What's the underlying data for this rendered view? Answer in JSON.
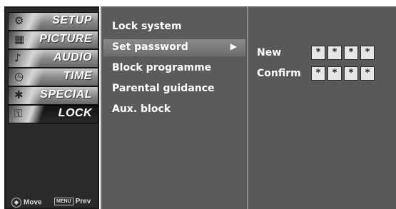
{
  "sidebar": {
    "tabs": [
      {
        "label": "SETUP",
        "icon": "setup-icon",
        "glyph": "⚙"
      },
      {
        "label": "PICTURE",
        "icon": "picture-icon",
        "glyph": "▦"
      },
      {
        "label": "AUDIO",
        "icon": "audio-icon",
        "glyph": "♪"
      },
      {
        "label": "TIME",
        "icon": "clock-icon",
        "glyph": "◷"
      },
      {
        "label": "SPECIAL",
        "icon": "special-icon",
        "glyph": "✱"
      },
      {
        "label": "LOCK",
        "icon": "lock-icon",
        "glyph": "⚿"
      }
    ],
    "active_tab": "LOCK",
    "hint_move": "Move",
    "hint_menu_key": "MENU",
    "hint_prev": "Prev"
  },
  "menu": {
    "items": [
      {
        "label": "Lock system"
      },
      {
        "label": "Set password"
      },
      {
        "label": "Block programme"
      },
      {
        "label": "Parental guidance"
      },
      {
        "label": "Aux. block"
      }
    ],
    "selected_item": "Set password",
    "submenu_arrow": "▶"
  },
  "password": {
    "new_label": "New",
    "confirm_label": "Confirm",
    "new_digits": [
      "*",
      "*",
      "*",
      "*"
    ],
    "confirm_digits": [
      "*",
      "*",
      "*",
      "*"
    ]
  }
}
